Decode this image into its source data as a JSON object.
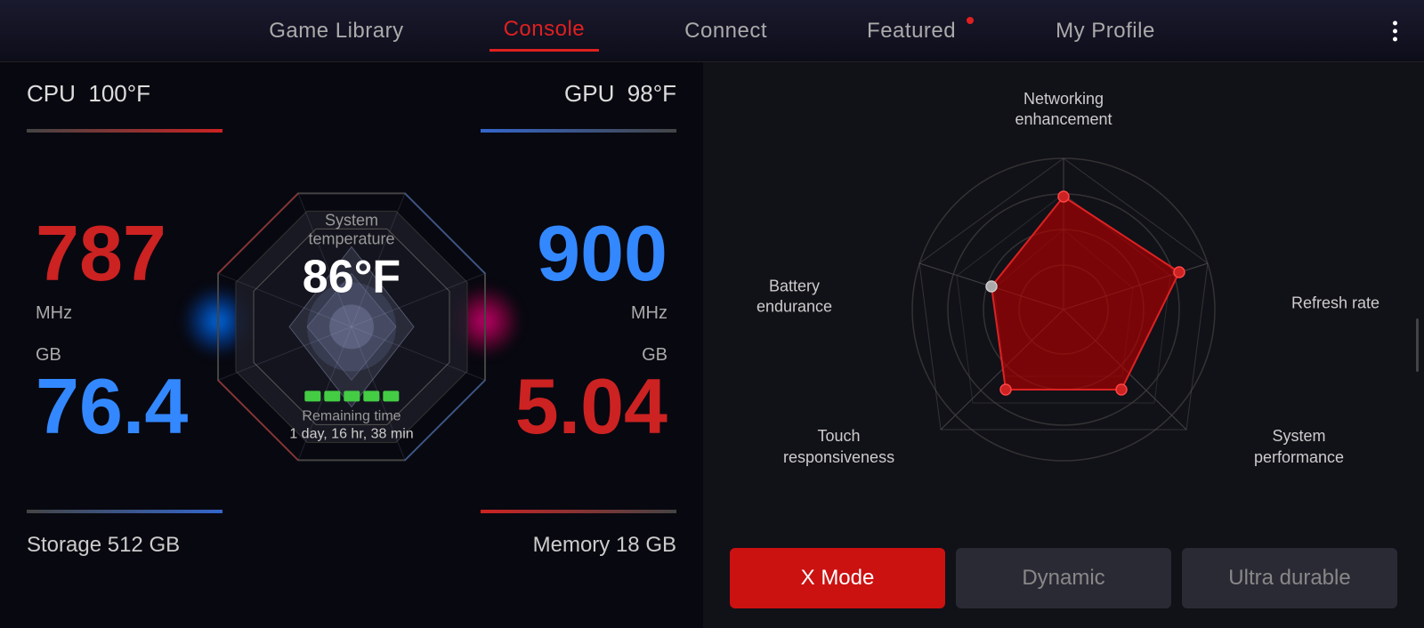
{
  "nav": {
    "tabs": [
      {
        "id": "game-library",
        "label": "Game Library",
        "active": false,
        "dot": false
      },
      {
        "id": "console",
        "label": "Console",
        "active": true,
        "dot": false
      },
      {
        "id": "connect",
        "label": "Connect",
        "active": false,
        "dot": false
      },
      {
        "id": "featured",
        "label": "Featured",
        "active": false,
        "dot": true
      },
      {
        "id": "my-profile",
        "label": "My Profile",
        "active": false,
        "dot": false
      }
    ]
  },
  "left": {
    "cpu_label": "CPU",
    "cpu_temp": "100°F",
    "gpu_label": "GPU",
    "gpu_temp": "98°F",
    "sys_temp_label": "System temperature",
    "sys_temp_value": "86°F",
    "cpu_mhz": "787",
    "cpu_mhz_unit": "MHz",
    "gpu_mhz": "900",
    "gpu_mhz_unit": "MHz",
    "cpu_gb": "76.4",
    "cpu_gb_unit": "GB",
    "gpu_gb": "5.04",
    "gpu_gb_unit": "GB",
    "remaining_label": "Remaining time",
    "remaining_value": "1 day, 16 hr, 38 min",
    "storage_label": "Storage  512 GB",
    "memory_label": "Memory  18 GB"
  },
  "radar": {
    "labels": {
      "top": "Networking\nenhancement",
      "right": "Refresh rate",
      "bottom_right": "System\nperformance",
      "bottom_left": "Touch\nresponsiveness",
      "left": "Battery\nendurance"
    }
  },
  "modes": [
    {
      "id": "x-mode",
      "label": "X Mode",
      "active": true
    },
    {
      "id": "dynamic",
      "label": "Dynamic",
      "active": false
    },
    {
      "id": "ultra-durable",
      "label": "Ultra durable",
      "active": false
    }
  ]
}
